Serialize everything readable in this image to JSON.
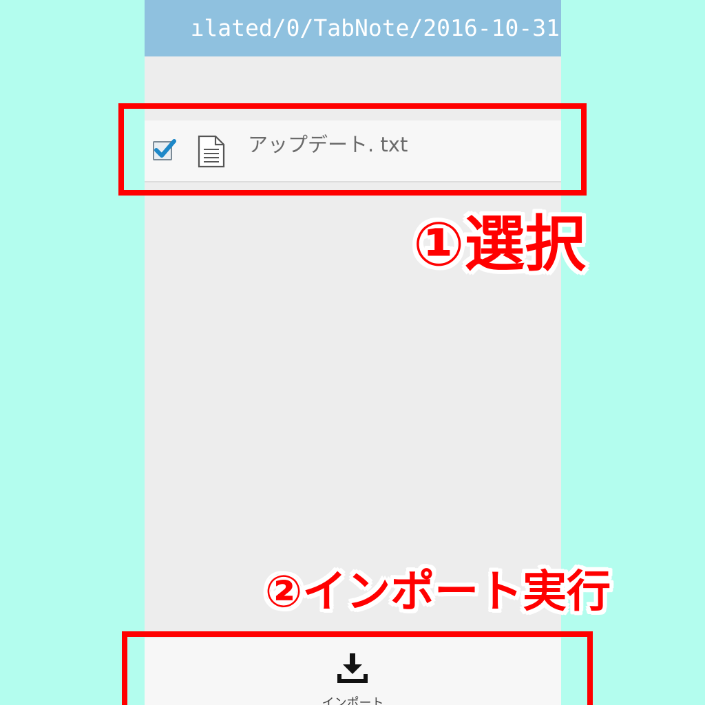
{
  "path_bar": {
    "text": "ılated/0/TabNote/2016-10-31"
  },
  "file_list": [
    {
      "name": "アップデート. txt",
      "checked": true,
      "icon": "text-file-icon"
    }
  ],
  "bottom_toolbar": {
    "import_label": "インポート",
    "import_icon": "download-icon"
  },
  "annotations": {
    "step1": "①選択",
    "step2": "②インポート実行"
  },
  "colors": {
    "background": "#b3fdee",
    "path_bar": "#8fc1df",
    "highlight": "#ff0000",
    "checkmark": "#1e88c8"
  }
}
